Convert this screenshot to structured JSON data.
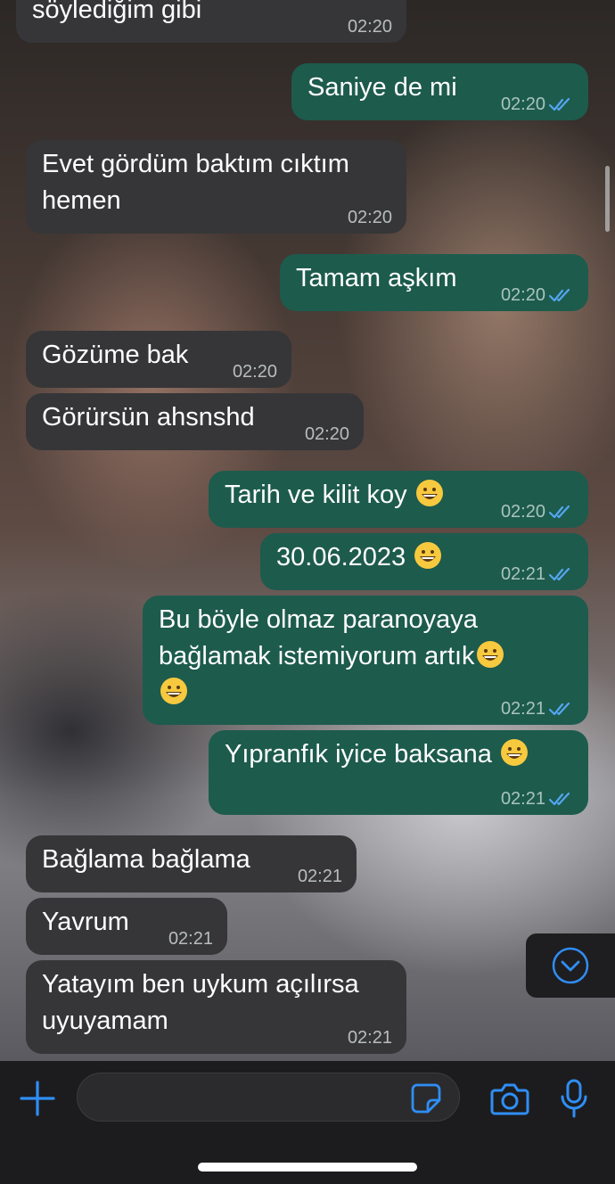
{
  "chat": {
    "messages": [
      {
        "dir": "in",
        "text": "söylediğim gibi",
        "time": "02:20"
      },
      {
        "dir": "out",
        "text": "Saniye de mi",
        "time": "02:20"
      },
      {
        "dir": "in",
        "text": "Evet gördüm baktım cıktım\nhemen",
        "time": "02:20"
      },
      {
        "dir": "out",
        "text": "Tamam aşkım",
        "time": "02:20"
      },
      {
        "dir": "in",
        "text": "Gözüme bak",
        "time": "02:20"
      },
      {
        "dir": "in",
        "text": "Görürsün ahsnshd",
        "time": "02:20"
      },
      {
        "dir": "out",
        "text": "Tarih ve kilit koy",
        "time": "02:20"
      },
      {
        "dir": "out",
        "text": "30.06.2023",
        "time": "02:21"
      },
      {
        "dir": "out",
        "text": "Bu böyle olmaz paranoyaya\nbağlamak istemiyorum artık",
        "time": "02:21"
      },
      {
        "dir": "out",
        "text": "Yıpranfık iyice baksana",
        "time": "02:21"
      },
      {
        "dir": "in",
        "text": "Bağlama bağlama",
        "time": "02:21"
      },
      {
        "dir": "in",
        "text": "Yavrum",
        "time": "02:21"
      },
      {
        "dir": "in",
        "text": "Yatayım ben uykum açılırsa\nuyuyamam",
        "time": "02:21"
      }
    ]
  },
  "icons": {
    "read_receipt": "double-check-icon",
    "emoji": "grinning-face-emoji",
    "scroll_down": "chevron-down-circle-icon",
    "add": "plus-icon",
    "sticker": "sticker-icon",
    "camera": "camera-icon",
    "mic": "microphone-icon"
  },
  "colors": {
    "incoming_bubble": "#363638",
    "outgoing_bubble": "#1d5b4d",
    "accent": "#2f8ef5",
    "read_ticks": "#54a6f0"
  }
}
